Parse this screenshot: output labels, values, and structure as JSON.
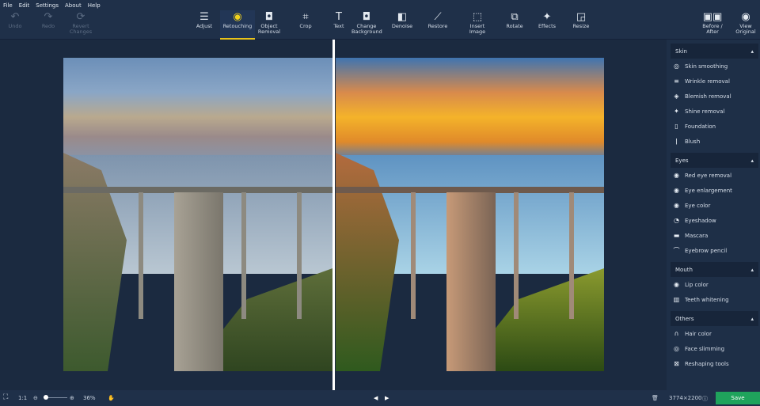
{
  "menu": [
    "File",
    "Edit",
    "Settings",
    "About",
    "Help"
  ],
  "history": [
    {
      "label": "Undo",
      "icon": "undo-icon",
      "glyph": "↶"
    },
    {
      "label": "Redo",
      "icon": "redo-icon",
      "glyph": "↷"
    },
    {
      "label": "Revert Changes",
      "icon": "revert-icon",
      "glyph": "⟳"
    }
  ],
  "tools": [
    {
      "label": "Adjust",
      "icon": "sliders-icon",
      "glyph": "☰"
    },
    {
      "label": "Retouching",
      "icon": "retouching-icon",
      "glyph": "◉",
      "active": true
    },
    {
      "label": "Object Removal",
      "icon": "object-removal-icon",
      "glyph": "◘"
    },
    {
      "label": "Crop",
      "icon": "crop-icon",
      "glyph": "⌗"
    },
    {
      "label": "Text",
      "icon": "text-icon",
      "glyph": "T"
    },
    {
      "label": "Change Background",
      "icon": "change-background-icon",
      "glyph": "◘"
    },
    {
      "label": "Denoise",
      "icon": "denoise-icon",
      "glyph": "◧"
    },
    {
      "label": "Restore",
      "icon": "restore-icon",
      "glyph": "⟋"
    },
    {
      "label": "Insert Image",
      "icon": "insert-image-icon",
      "glyph": "⬚"
    },
    {
      "label": "Rotate",
      "icon": "rotate-icon",
      "glyph": "⧉"
    },
    {
      "label": "Effects",
      "icon": "effects-icon",
      "glyph": "✦"
    },
    {
      "label": "Resize",
      "icon": "resize-icon",
      "glyph": "◲"
    }
  ],
  "view": [
    {
      "label": "Before / After",
      "icon": "before-after-icon",
      "glyph": "▣▣"
    },
    {
      "label": "View Original",
      "icon": "eye-icon",
      "glyph": "◉"
    }
  ],
  "sidebar": [
    {
      "title": "Skin",
      "items": [
        {
          "label": "Skin smoothing",
          "glyph": "◎"
        },
        {
          "label": "Wrinkle removal",
          "glyph": "≡"
        },
        {
          "label": "Blemish removal",
          "glyph": "◈"
        },
        {
          "label": "Shine removal",
          "glyph": "✦"
        },
        {
          "label": "Foundation",
          "glyph": "▯"
        },
        {
          "label": "Blush",
          "glyph": "ǀ"
        }
      ]
    },
    {
      "title": "Eyes",
      "items": [
        {
          "label": "Red eye removal",
          "glyph": "◉"
        },
        {
          "label": "Eye enlargement",
          "glyph": "◉"
        },
        {
          "label": "Eye color",
          "glyph": "◉"
        },
        {
          "label": "Eyeshadow",
          "glyph": "◔"
        },
        {
          "label": "Mascara",
          "glyph": "▬"
        },
        {
          "label": "Eyebrow pencil",
          "glyph": "⌒"
        }
      ]
    },
    {
      "title": "Mouth",
      "items": [
        {
          "label": "Lip color",
          "glyph": "◉"
        },
        {
          "label": "Teeth whitening",
          "glyph": "▥"
        }
      ]
    },
    {
      "title": "Others",
      "items": [
        {
          "label": "Hair color",
          "glyph": "∩"
        },
        {
          "label": "Face slimming",
          "glyph": "◎"
        },
        {
          "label": "Reshaping tools",
          "glyph": "⊠"
        }
      ]
    }
  ],
  "status": {
    "fit": "⛶",
    "ratio": "1:1",
    "zoom": "36%",
    "zoom_value": 36,
    "dimensions": "3774×2200",
    "save": "Save"
  },
  "colors": {
    "accent": "#e8c21a",
    "save": "#1fa35c"
  }
}
